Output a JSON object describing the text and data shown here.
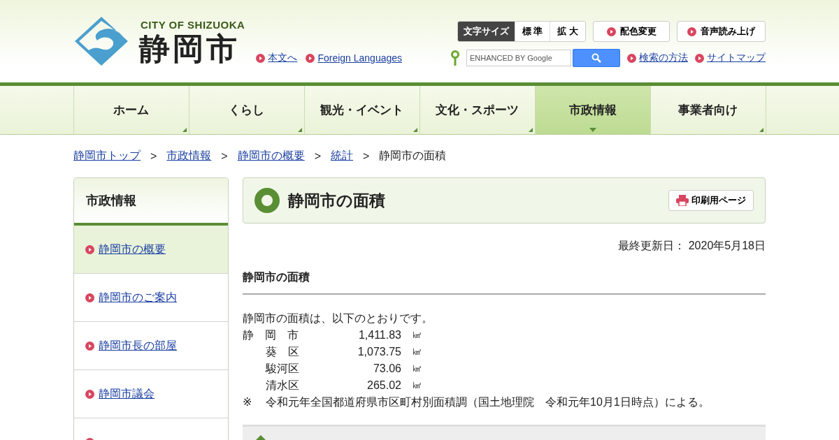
{
  "header": {
    "city_en": "CITY OF SHIZUOKA",
    "city_ja": "静岡市",
    "links": [
      "本文へ",
      "Foreign Languages"
    ],
    "font_size": {
      "label": "文字サイズ",
      "options": [
        "標 準",
        "拡 大"
      ]
    },
    "tools": [
      "配色変更",
      "音声読み上げ"
    ],
    "search": {
      "placeholder": "ENHANCED BY Google",
      "links": [
        "検索の方法",
        "サイトマップ"
      ]
    }
  },
  "nav": [
    {
      "label": "ホーム",
      "selected": false
    },
    {
      "label": "くらし",
      "selected": false
    },
    {
      "label": "観光・イベント",
      "selected": false
    },
    {
      "label": "文化・スポーツ",
      "selected": false
    },
    {
      "label": "市政情報",
      "selected": true
    },
    {
      "label": "事業者向け",
      "selected": false
    }
  ],
  "breadcrumb": {
    "links": [
      "静岡市トップ",
      "市政情報",
      "静岡市の概要",
      "統計"
    ],
    "separator": ">",
    "current": "静岡市の面積"
  },
  "sidebar": {
    "title": "市政情報",
    "items": [
      {
        "label": "静岡市の概要",
        "selected": true
      },
      {
        "label": "静岡市のご案内",
        "selected": false
      },
      {
        "label": "静岡市長の部屋",
        "selected": false
      },
      {
        "label": "静岡市議会",
        "selected": false
      },
      {
        "selected": false
      }
    ]
  },
  "main": {
    "title": "静岡市の面積",
    "print": "印刷用ページ",
    "updated": "最終更新日： 2020年5月18日",
    "heading": "静岡市の面積",
    "intro": "静岡市の面積は、以下のとおりです。",
    "areas": [
      {
        "name": "静　岡　市",
        "value": "1,411.83",
        "unit": "㎢",
        "children": [
          {
            "name": "葵　区",
            "value": "1,073.75",
            "unit": "㎢"
          },
          {
            "name": "駿河区",
            "value": "73.06",
            "unit": "㎢"
          },
          {
            "name": "清水区",
            "value": "265.02",
            "unit": "㎢"
          }
        ]
      }
    ],
    "note_mark": "※",
    "note": "令和元年全国都道府県市区町村別面積調（国土地理院　令和元年10月1日時点）による。"
  }
}
